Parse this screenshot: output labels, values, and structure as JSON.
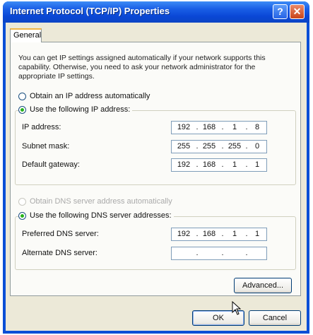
{
  "window": {
    "title": "Internet Protocol (TCP/IP) Properties",
    "help_label": "?",
    "close_label": "✕"
  },
  "tabs": [
    {
      "label": "General"
    }
  ],
  "description": "You can get IP settings assigned automatically if your network supports this capability. Otherwise, you need to ask your network administrator for the appropriate IP settings.",
  "ip_mode": {
    "auto_label": "Obtain an IP address automatically",
    "manual_label": "Use the following IP address:",
    "selected": "manual"
  },
  "ip_fields": [
    {
      "label": "IP address:",
      "octets": [
        "192",
        "168",
        "1",
        "8"
      ]
    },
    {
      "label": "Subnet mask:",
      "octets": [
        "255",
        "255",
        "255",
        "0"
      ]
    },
    {
      "label": "Default gateway:",
      "octets": [
        "192",
        "168",
        "1",
        "1"
      ]
    }
  ],
  "dns_mode": {
    "auto_label": "Obtain DNS server address automatically",
    "manual_label": "Use the following DNS server addresses:",
    "selected": "manual"
  },
  "dns_fields": [
    {
      "label": "Preferred DNS server:",
      "octets": [
        "192",
        "168",
        "1",
        "1"
      ]
    },
    {
      "label": "Alternate DNS server:",
      "octets": [
        "",
        "",
        "",
        ""
      ]
    }
  ],
  "buttons": {
    "advanced": "Advanced...",
    "ok": "OK",
    "cancel": "Cancel"
  },
  "separator": ".",
  "colors": {
    "titlebar": "#0a47d6",
    "radio_selected": "#27b31c",
    "client": "#ece9d8"
  }
}
